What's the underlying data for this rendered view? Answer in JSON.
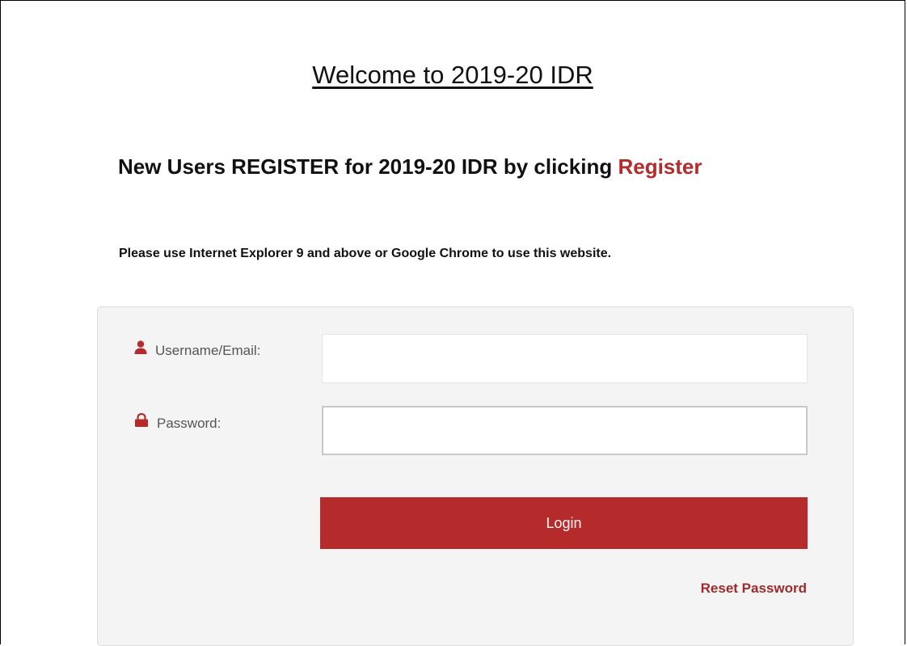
{
  "header": {
    "welcome_title": "Welcome to 2019-20 IDR"
  },
  "register": {
    "prefix_text": "New Users REGISTER for 2019-20 IDR by clicking ",
    "link_label": "Register"
  },
  "browser_note": "Please use Internet Explorer 9 and above or Google Chrome to use this website.",
  "login_form": {
    "username_label": "Username/Email:",
    "username_value": "",
    "username_icon": "user-icon",
    "password_label": "Password:",
    "password_value": "",
    "password_icon": "lock-icon",
    "login_button_label": "Login",
    "reset_password_label": "Reset Password"
  },
  "colors": {
    "accent_red": "#b52a2a",
    "reset_link_red": "#9e2b2b",
    "panel_background": "#f4f4f4",
    "label_gray": "#555555"
  }
}
